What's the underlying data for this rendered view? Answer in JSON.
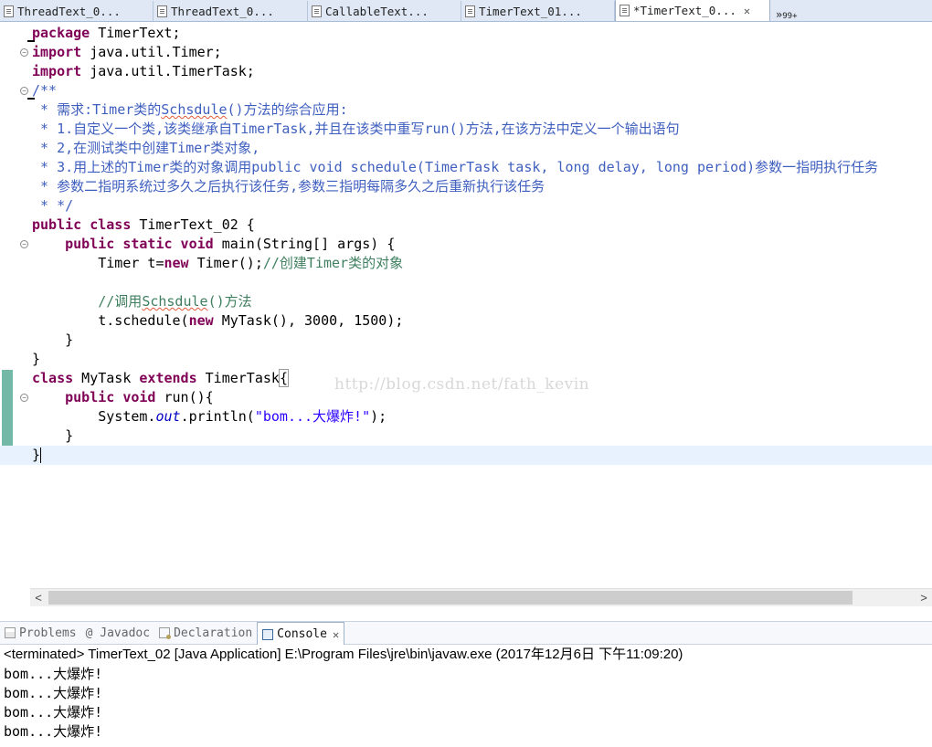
{
  "editor_tabs": [
    {
      "label": "ThreadText_0..."
    },
    {
      "label": "ThreadText_0..."
    },
    {
      "label": "CallableText..."
    },
    {
      "label": "TimerText_01..."
    },
    {
      "label": "*TimerText_0...",
      "active": true,
      "close": "✕"
    }
  ],
  "tab_overflow": {
    "label": "»",
    "count": "99+"
  },
  "code": {
    "l1_kw": "package",
    "l1_rest": " TimerText;",
    "l2_kw": "import",
    "l2_rest": " java.util.Timer;",
    "l3_kw": "import",
    "l3_rest": " java.util.TimerTask;",
    "l4": "/**",
    "l5a": " * 需求:Timer类的",
    "l5b": "Schsdule",
    "l5c": "()方法的综合应用:",
    "l6": " * 1.自定义一个类,该类继承自TimerTask,并且在该类中重写run()方法,在该方法中定义一个输出语句",
    "l7": " * 2,在测试类中创建Timer类对象,",
    "l8": " * 3.用上述的Timer类的对象调用public void schedule(TimerTask task, long delay, long period)参数一指明执行任务",
    "l9": " * 参数二指明系统过多久之后执行该任务,参数三指明每隔多久之后重新执行该任务",
    "l10": " * */",
    "l11_kw": "public class",
    "l11_rest": " TimerText_02 {",
    "l12_indent": "    ",
    "l12_kw": "public static void",
    "l12_rest": " main(String[] args) {",
    "l13_indent": "        ",
    "l13_a": "Timer t=",
    "l13_kw": "new",
    "l13_b": " Timer();",
    "l13_c": "//创建Timer类的对象",
    "l15_indent": "        ",
    "l15_a": "//调用",
    "l15_b": "Schsdule",
    "l15_c": "()方法",
    "l16_indent": "        ",
    "l16_a": "t.schedule(",
    "l16_kw": "new",
    "l16_b": " MyTask(), 3000, 1500);",
    "l17": "    }",
    "l18": "}",
    "l19_kw1": "class",
    "l19_a": " MyTask ",
    "l19_kw2": "extends",
    "l19_b": " TimerTask",
    "l19_brace": "{",
    "l20_indent": "    ",
    "l20_kw": "public void",
    "l20_rest": " run(){",
    "l21_indent": "        ",
    "l21_a": "System.",
    "l21_it": "out",
    "l21_b": ".println(",
    "l21_st": "\"bom...大爆炸!\"",
    "l21_c": ");",
    "l22": "    }",
    "l23": "}"
  },
  "watermark": "http://blog.csdn.net/fath_kevin",
  "scrollbar": {
    "left": "<",
    "right": ">"
  },
  "panel_tabs": [
    {
      "label": "Problems"
    },
    {
      "label": "@ Javadoc"
    },
    {
      "label": "Declaration"
    },
    {
      "label": "Console",
      "active": true,
      "close": "✕"
    }
  ],
  "console": {
    "terminated": "<terminated> TimerText_02 [Java Application] E:\\Program Files\\jre\\bin\\javaw.exe (2017年12月6日 下午11:09:20)",
    "output": [
      "bom...大爆炸!",
      "bom...大爆炸!",
      "bom...大爆炸!",
      "bom...大爆炸!"
    ]
  }
}
